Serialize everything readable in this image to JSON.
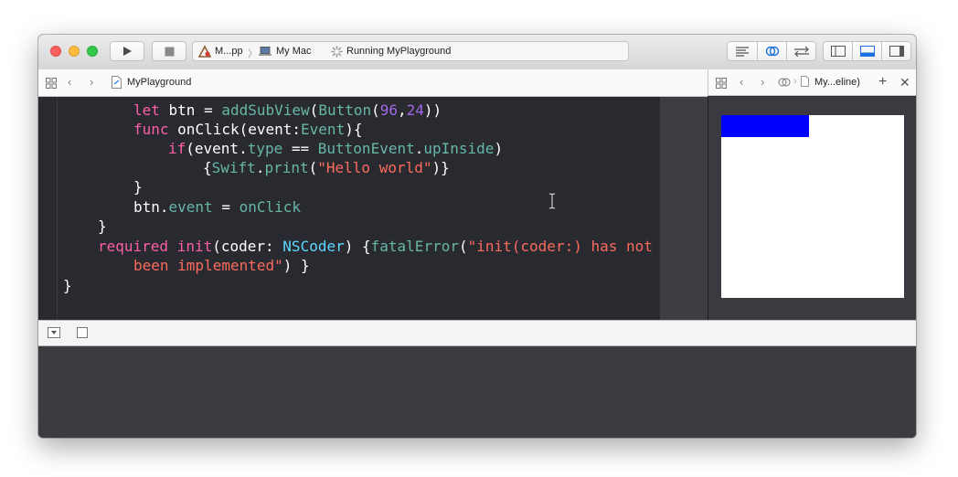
{
  "toolbar": {
    "scheme_target": "M...pp",
    "scheme_separator": "〉",
    "scheme_device": "My Mac",
    "status": "Running MyPlayground"
  },
  "editor_nav": {
    "filename": "MyPlayground"
  },
  "assistant_nav": {
    "title": "My...eline)"
  },
  "code_lines": {
    "l1a": "let ",
    "l1b": "btn",
    "l1c": " = ",
    "l1d": "addSubView",
    "l1e": "(",
    "l1f": "Button",
    "l1g": "(",
    "l1h": "96",
    "l1i": ",",
    "l1j": "24",
    "l1k": "))",
    "l2a": "func ",
    "l2b": "onClick(event:",
    "l2c": "Event",
    "l2d": "){",
    "l3a": "if",
    "l3b": "(event.",
    "l3c": "type",
    "l3d": " == ",
    "l3e": "ButtonEvent",
    "l3f": ".",
    "l3g": "upInside",
    "l3h": ")",
    "l4a": "{",
    "l4b": "Swift",
    "l4c": ".",
    "l4d": "print",
    "l4e": "(",
    "l4f": "\"Hello world\"",
    "l4g": ")}",
    "l5": "}",
    "l6a": "btn.",
    "l6b": "event",
    "l6c": " = ",
    "l6d": "onClick",
    "l7": "}",
    "l8a": "required ",
    "l8b": "init",
    "l8c": "(coder: ",
    "l8d": "NSCoder",
    "l8e": ") {",
    "l8f": "fatalError",
    "l8g": "(",
    "l8h": "\"init(coder:) has not",
    "l9a": "been implemented\"",
    "l9b": ") }",
    "l10": "}"
  },
  "colors": {
    "accent_blue": "#0000ff",
    "editor_bg": "#292a30",
    "keyword": "#fc5fa3",
    "string": "#fc6a5d",
    "type": "#5dd8ff"
  }
}
